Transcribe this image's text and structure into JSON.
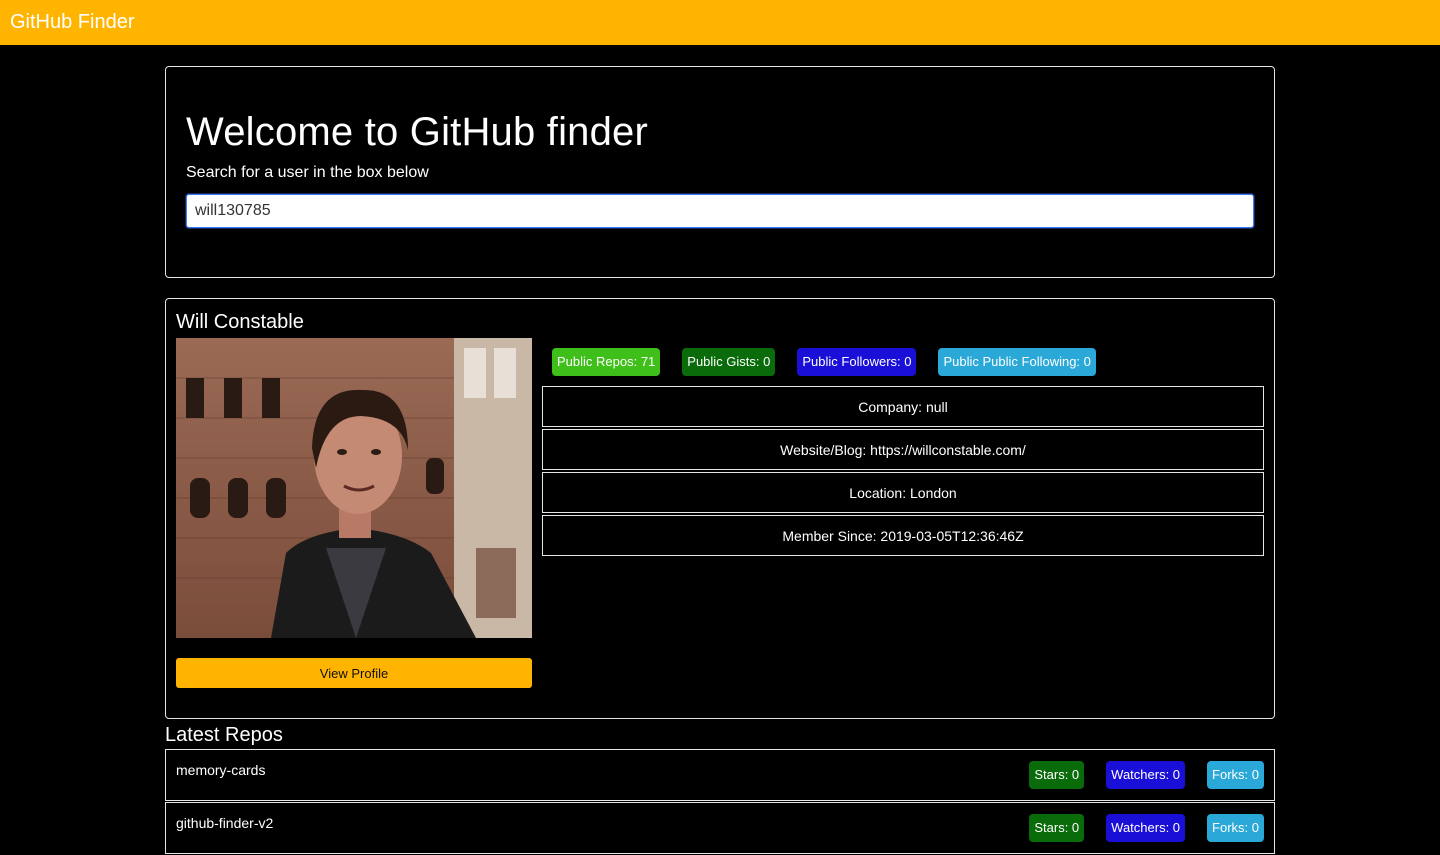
{
  "navbar": {
    "brand": "GitHub Finder"
  },
  "search": {
    "title": "Welcome to GitHub finder",
    "lead": "Search for a user in the box below",
    "value": "will130785"
  },
  "profile": {
    "name": "Will Constable",
    "view_profile_label": "View Profile",
    "badges": {
      "repos": "Public Repos: 71",
      "gists": "Public Gists: 0",
      "followers": "Public Followers: 0",
      "following": "Public Public Following: 0"
    },
    "info": {
      "company": "Company: null",
      "website": "Website/Blog: https://willconstable.com/",
      "location": "Location: London",
      "member_since": "Member Since: 2019-03-05T12:36:46Z"
    }
  },
  "repos": {
    "title": "Latest Repos",
    "items": [
      {
        "name": "memory-cards",
        "stars": "Stars: 0",
        "watchers": "Watchers: 0",
        "forks": "Forks: 0"
      },
      {
        "name": "github-finder-v2",
        "stars": "Stars: 0",
        "watchers": "Watchers: 0",
        "forks": "Forks: 0"
      }
    ]
  },
  "colors": {
    "brand": "#ffb400",
    "badge_success": "#3fbf1a",
    "badge_dark_green": "#0a6b0a",
    "badge_primary": "#1a0fd6",
    "badge_info": "#2aa8d8"
  }
}
